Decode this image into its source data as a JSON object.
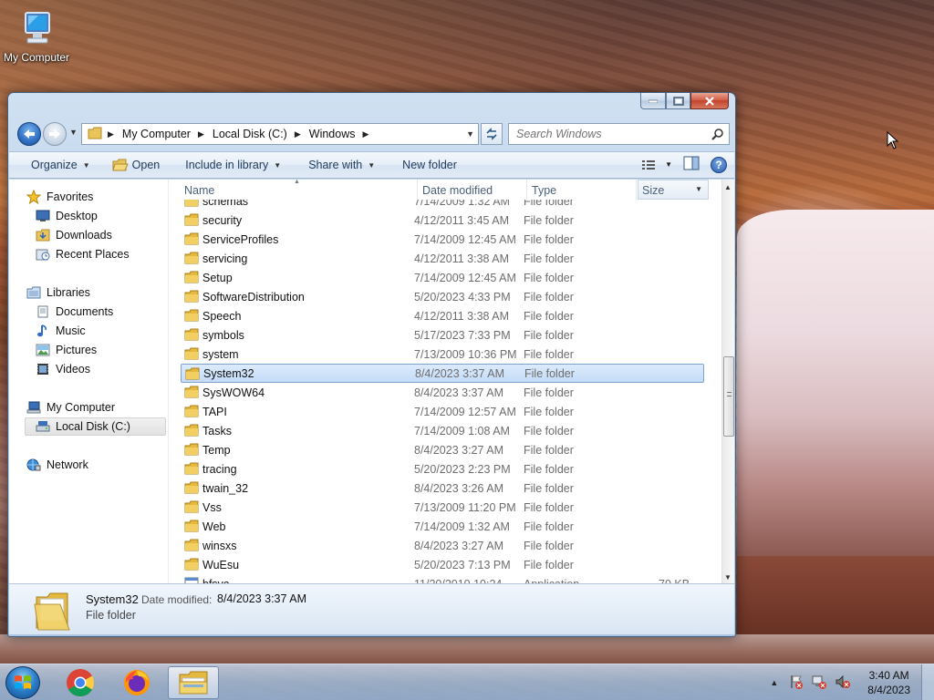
{
  "desktop": {
    "icon_label": "My Computer"
  },
  "window": {
    "caption_buttons": [
      "minimize",
      "maximize",
      "close"
    ],
    "address": {
      "crumbs": [
        "My Computer",
        "Local Disk (C:)",
        "Windows"
      ]
    },
    "search": {
      "placeholder": "Search Windows"
    },
    "toolbar": {
      "organize": "Organize",
      "open": "Open",
      "include_in_library": "Include in library",
      "share_with": "Share with",
      "new_folder": "New folder"
    },
    "nav_pane": {
      "favorites": "Favorites",
      "desktop": "Desktop",
      "downloads": "Downloads",
      "recent_places": "Recent Places",
      "libraries": "Libraries",
      "documents": "Documents",
      "music": "Music",
      "pictures": "Pictures",
      "videos": "Videos",
      "my_computer": "My Computer",
      "local_disk": "Local Disk (C:)",
      "network": "Network"
    },
    "columns": {
      "name": "Name",
      "date_modified": "Date modified",
      "type": "Type",
      "size": "Size"
    },
    "files": [
      {
        "name": "schemas",
        "date": "7/14/2009 1:32 AM",
        "type": "File folder",
        "size": ""
      },
      {
        "name": "security",
        "date": "4/12/2011 3:45 AM",
        "type": "File folder",
        "size": ""
      },
      {
        "name": "ServiceProfiles",
        "date": "7/14/2009 12:45 AM",
        "type": "File folder",
        "size": ""
      },
      {
        "name": "servicing",
        "date": "4/12/2011 3:38 AM",
        "type": "File folder",
        "size": ""
      },
      {
        "name": "Setup",
        "date": "7/14/2009 12:45 AM",
        "type": "File folder",
        "size": ""
      },
      {
        "name": "SoftwareDistribution",
        "date": "5/20/2023 4:33 PM",
        "type": "File folder",
        "size": ""
      },
      {
        "name": "Speech",
        "date": "4/12/2011 3:38 AM",
        "type": "File folder",
        "size": ""
      },
      {
        "name": "symbols",
        "date": "5/17/2023 7:33 PM",
        "type": "File folder",
        "size": ""
      },
      {
        "name": "system",
        "date": "7/13/2009 10:36 PM",
        "type": "File folder",
        "size": ""
      },
      {
        "name": "System32",
        "date": "8/4/2023 3:37 AM",
        "type": "File folder",
        "size": ""
      },
      {
        "name": "SysWOW64",
        "date": "8/4/2023 3:37 AM",
        "type": "File folder",
        "size": ""
      },
      {
        "name": "TAPI",
        "date": "7/14/2009 12:57 AM",
        "type": "File folder",
        "size": ""
      },
      {
        "name": "Tasks",
        "date": "7/14/2009 1:08 AM",
        "type": "File folder",
        "size": ""
      },
      {
        "name": "Temp",
        "date": "8/4/2023 3:27 AM",
        "type": "File folder",
        "size": ""
      },
      {
        "name": "tracing",
        "date": "5/20/2023 2:23 PM",
        "type": "File folder",
        "size": ""
      },
      {
        "name": "twain_32",
        "date": "8/4/2023 3:26 AM",
        "type": "File folder",
        "size": ""
      },
      {
        "name": "Vss",
        "date": "7/13/2009 11:20 PM",
        "type": "File folder",
        "size": ""
      },
      {
        "name": "Web",
        "date": "7/14/2009 1:32 AM",
        "type": "File folder",
        "size": ""
      },
      {
        "name": "winsxs",
        "date": "8/4/2023 3:27 AM",
        "type": "File folder",
        "size": ""
      },
      {
        "name": "WuEsu",
        "date": "5/20/2023 7:13 PM",
        "type": "File folder",
        "size": ""
      },
      {
        "name": "bfsvc",
        "date": "11/20/2010 10:24 ...",
        "type": "Application",
        "size": "70 KB"
      }
    ],
    "selected_file": "System32",
    "details": {
      "name": "System32",
      "modified_label": "Date modified:",
      "modified_value": "8/4/2023 3:37 AM",
      "type": "File folder"
    }
  },
  "taskbar": {
    "pinned": [
      "start-button",
      "chrome",
      "firefox",
      "windows-explorer"
    ],
    "active": "windows-explorer",
    "clock_time": "3:40 AM",
    "clock_date": "8/4/2023"
  }
}
